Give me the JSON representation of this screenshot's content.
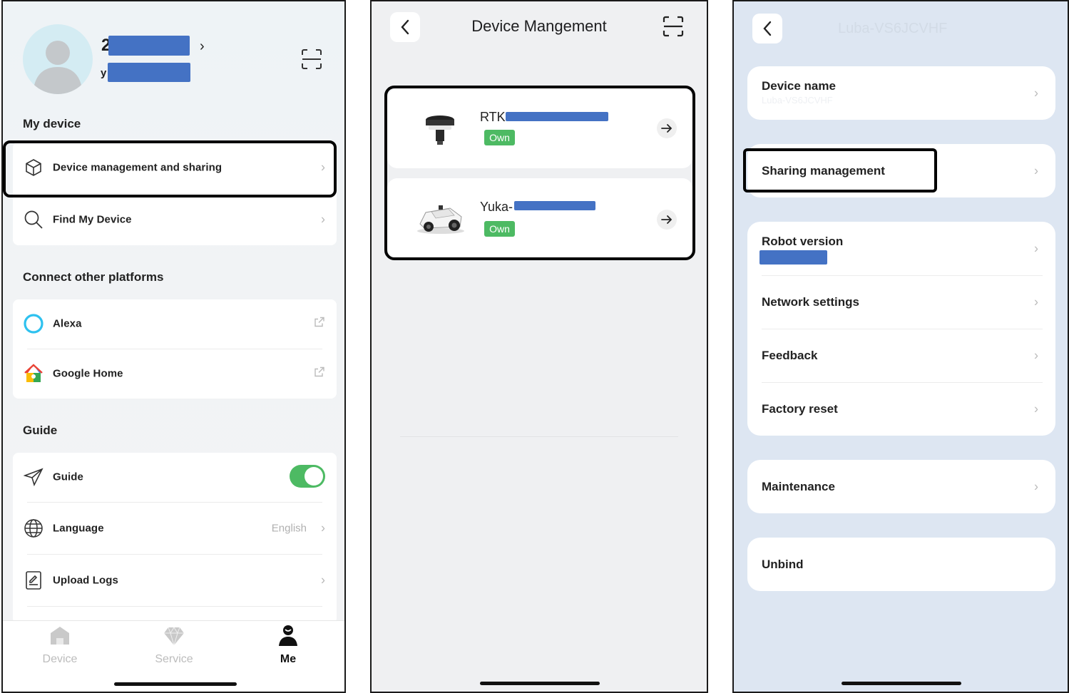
{
  "panel_me": {
    "user": {
      "name_visible": "2",
      "sub_visible": "y"
    },
    "section_my_device": "My device",
    "my_device_items": [
      {
        "label": "Device management and sharing",
        "icon": "cube-icon"
      },
      {
        "label": "Find My Device",
        "icon": "search-icon"
      }
    ],
    "section_platforms": "Connect other platforms",
    "platform_items": [
      {
        "label": "Alexa",
        "icon": "alexa-icon"
      },
      {
        "label": "Google Home",
        "icon": "google-home-icon"
      }
    ],
    "section_guide": "Guide",
    "guide_items": [
      {
        "label": "Guide",
        "icon": "paper-plane-icon",
        "toggle_on": true
      },
      {
        "label": "Language",
        "icon": "globe-icon",
        "value": "English"
      },
      {
        "label": "Upload Logs",
        "icon": "document-icon"
      }
    ],
    "tabs": [
      {
        "label": "Device",
        "icon": "home-icon",
        "active": false
      },
      {
        "label": "Service",
        "icon": "diamond-icon",
        "active": false
      },
      {
        "label": "Me",
        "icon": "person-icon",
        "active": true
      }
    ]
  },
  "panel_devices": {
    "title": "Device Mangement",
    "devices": [
      {
        "name_prefix": "RTK",
        "badge": "Own",
        "type": "rtk-station"
      },
      {
        "name_prefix": "Yuka-",
        "badge": "Own",
        "type": "robot-mower"
      }
    ]
  },
  "panel_settings": {
    "title": "Luba-VS6JCVHF",
    "device_name_label": "Device name",
    "device_name_value": "Luba-VS6JCVHF",
    "sharing_label": "Sharing management",
    "group_items": [
      "Robot version",
      "Network settings",
      "Feedback",
      "Factory reset"
    ],
    "maintenance_label": "Maintenance",
    "unbind_label": "Unbind"
  },
  "colors": {
    "accent_green": "#4dba63",
    "redaction_blue": "#4472c4",
    "highlight_border": "#000000"
  }
}
